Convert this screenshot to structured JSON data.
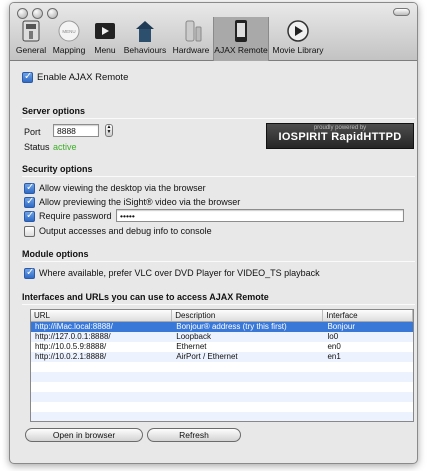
{
  "toolbar": {
    "items": [
      {
        "label": "General",
        "icon": "general-icon"
      },
      {
        "label": "Mapping",
        "icon": "mapping-icon"
      },
      {
        "label": "Menu",
        "icon": "menu-icon"
      },
      {
        "label": "Behaviours",
        "icon": "behaviours-icon"
      },
      {
        "label": "Hardware",
        "icon": "hardware-icon"
      },
      {
        "label": "AJAX Remote",
        "icon": "phone-icon"
      },
      {
        "label": "Movie Library",
        "icon": "play-icon"
      }
    ],
    "selected": "AJAX Remote"
  },
  "enable_ajax": {
    "label": "Enable AJAX Remote",
    "checked": true
  },
  "server": {
    "title": "Server options",
    "port_label": "Port",
    "port_value": "8888",
    "status_label": "Status",
    "status_value": "active",
    "status_color": "#3fae2a",
    "banner_small": "proudly powered by",
    "banner_big": "IOSPIRIT RapidHTTPD"
  },
  "security": {
    "title": "Security options",
    "options": [
      {
        "label": "Allow viewing the desktop via the browser",
        "checked": true
      },
      {
        "label": "Allow previewing the iSight® video via the browser",
        "checked": true
      },
      {
        "label": "Require password",
        "checked": true
      },
      {
        "label": "Output accesses and debug info to console",
        "checked": false
      }
    ],
    "password_value": "•••••"
  },
  "module": {
    "title": "Module options",
    "option": {
      "label": "Where available, prefer VLC over DVD Player for VIDEO_TS playback",
      "checked": true
    }
  },
  "interfaces": {
    "title": "Interfaces and URLs you can use to access AJAX Remote",
    "columns": [
      "URL",
      "Description",
      "Interface"
    ],
    "rows": [
      [
        "http://iMac.local:8888/",
        "Bonjour® address (try this first)",
        "Bonjour"
      ],
      [
        "http://127.0.0.1:8888/",
        "Loopback",
        "lo0"
      ],
      [
        "http://10.0.5.9:8888/",
        "Ethernet",
        "en0"
      ],
      [
        "http://10.0.2.1:8888/",
        "AirPort / Ethernet",
        "en1"
      ]
    ],
    "selected_row": 0
  },
  "buttons": {
    "open": "Open in browser",
    "refresh": "Refresh"
  }
}
